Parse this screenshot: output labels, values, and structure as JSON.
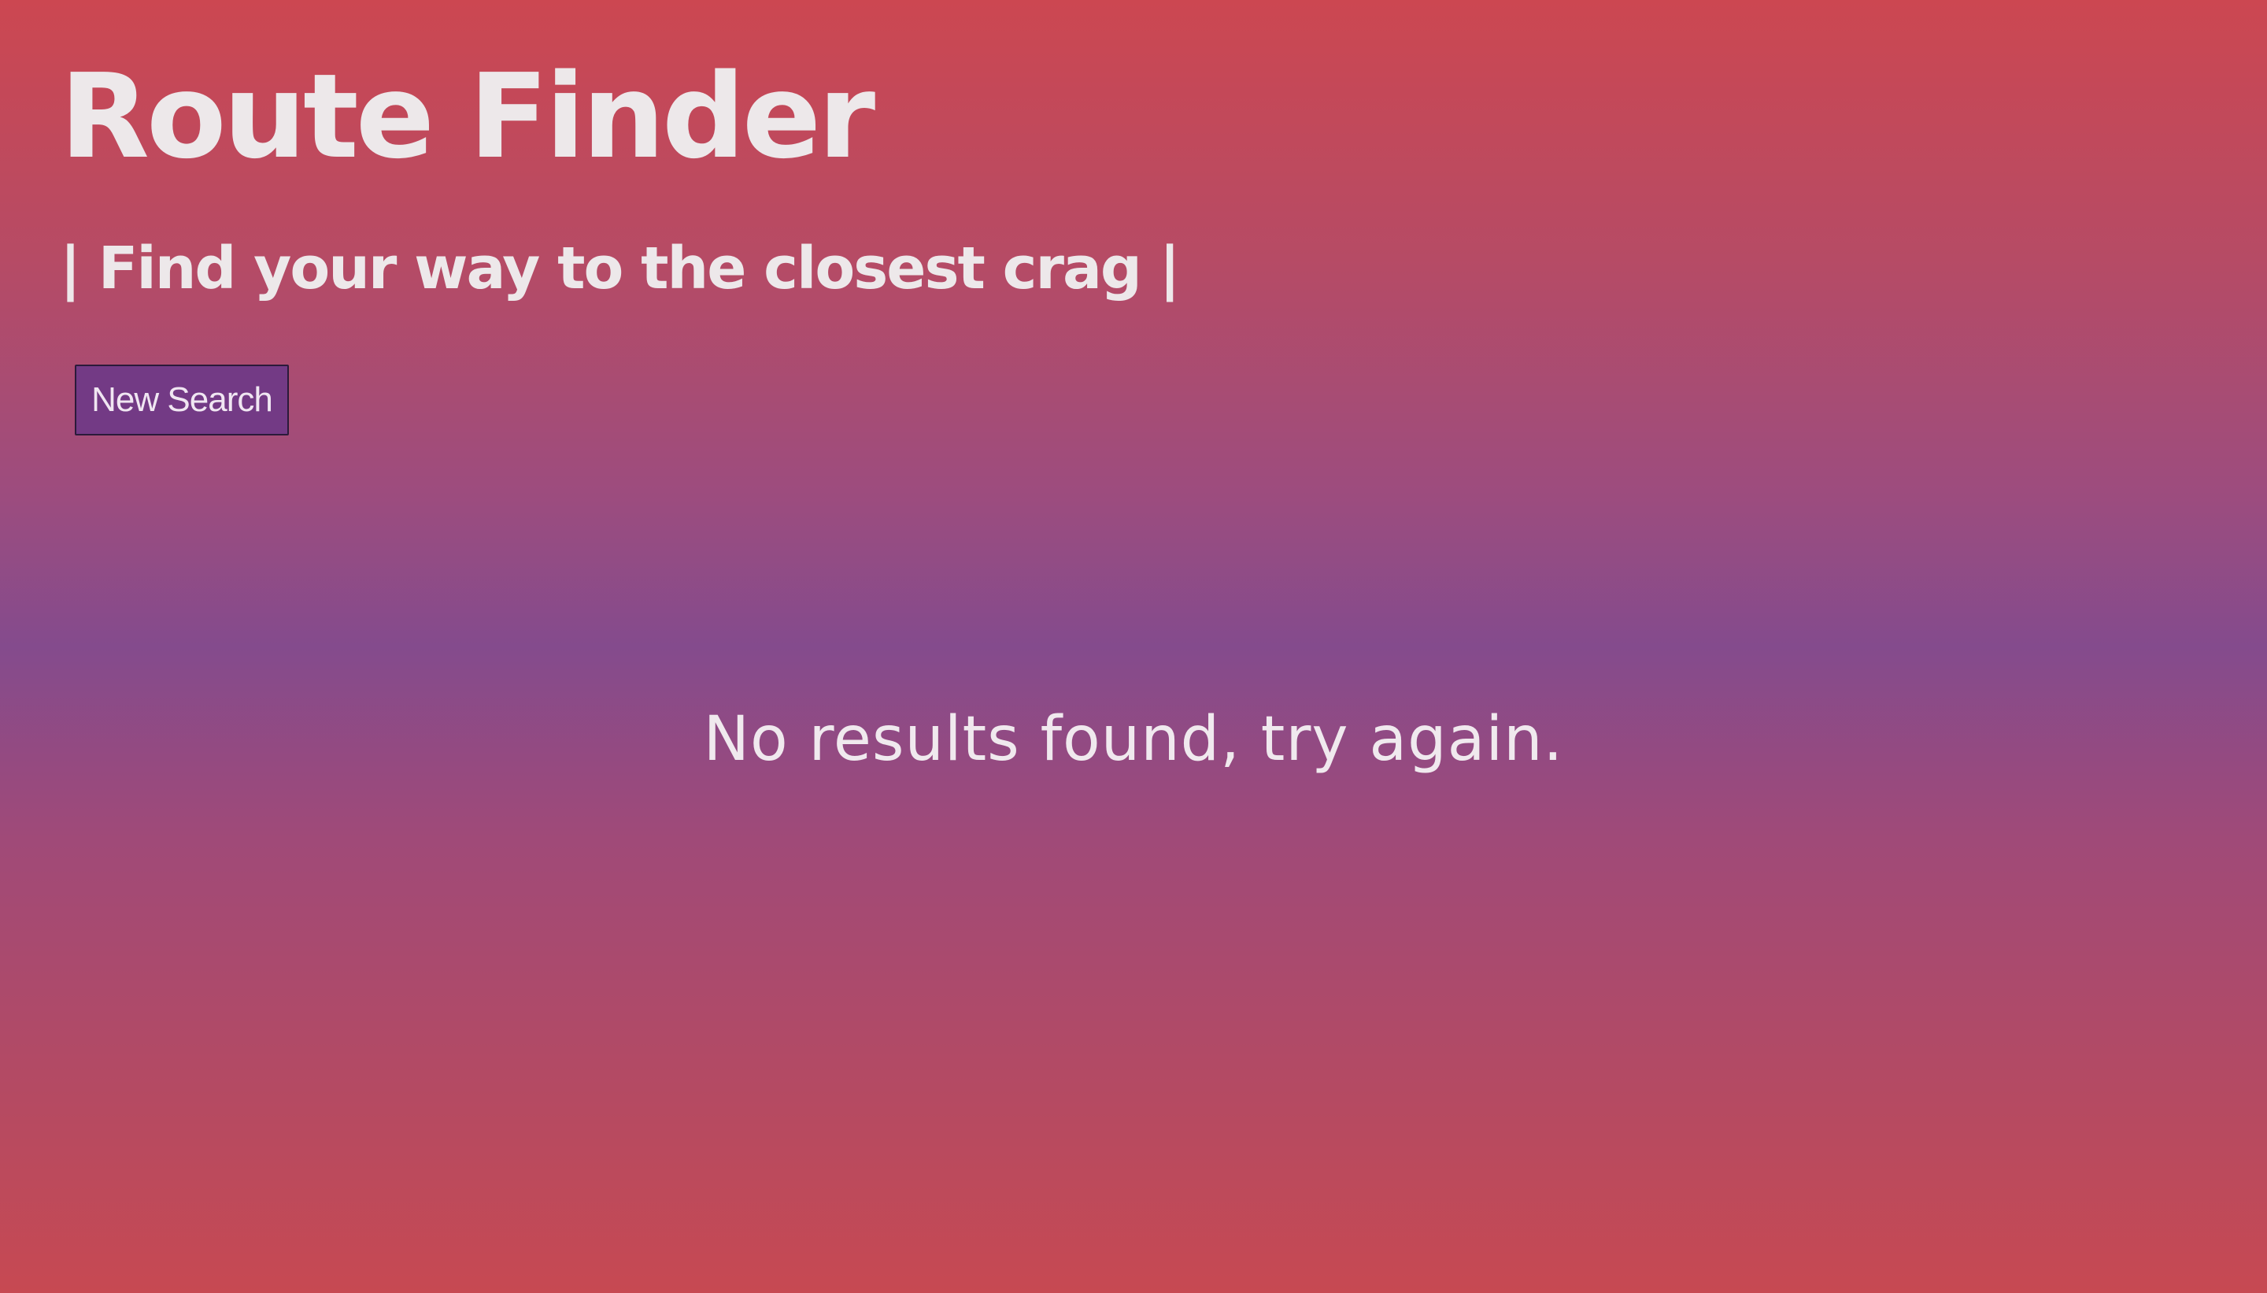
{
  "header": {
    "title": "Route Finder",
    "tagline": "| Find your way to the closest crag |"
  },
  "actions": {
    "new_search_label": "New Search"
  },
  "results": {
    "empty_message": "No results found, try again."
  },
  "colors": {
    "background_top": "#cc4751",
    "background_middle": "#844b8d",
    "background_bottom": "#c74952",
    "button_background": "#733a85",
    "text": "#ede8ea"
  }
}
